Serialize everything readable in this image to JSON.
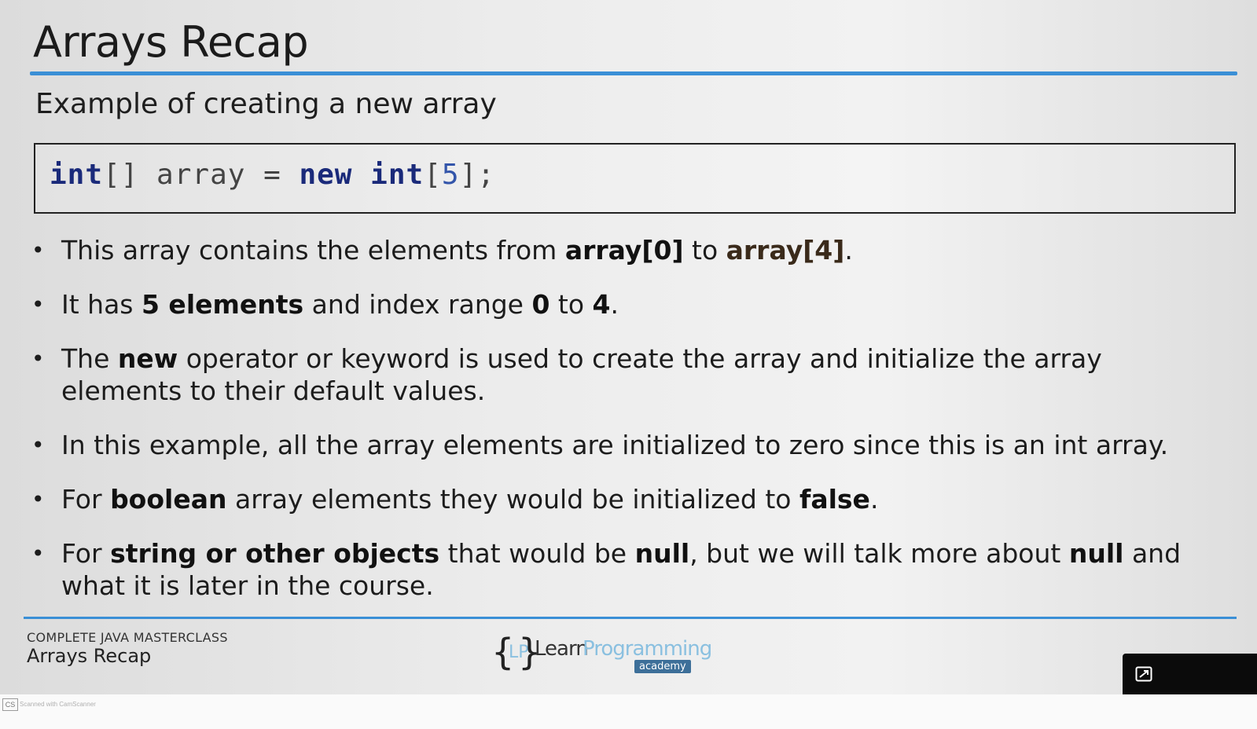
{
  "slide": {
    "title": "Arrays Recap",
    "subtitle": "Example of creating a new array",
    "code": {
      "t1": "int",
      "t2": "[] array = ",
      "t3": "new",
      "t4": " ",
      "t5": "int",
      "t6": "[",
      "t7": "5",
      "t8": "];"
    },
    "bullets": [
      {
        "a": "This array contains the elements from ",
        "b": "array[0]",
        "c": " to ",
        "d": "array[4]",
        "e": "."
      },
      {
        "a": "It has ",
        "b": "5 elements",
        "c": " and index range ",
        "d": "0",
        "e": " to ",
        "f": "4",
        "g": "."
      },
      {
        "a": "The ",
        "b": "new",
        "c": " operator or keyword is used to create the array and initialize the array elements to their default values."
      },
      {
        "a": "In this example, all the array elements are initialized to zero since this is an int array."
      },
      {
        "a": "For ",
        "b": "boolean",
        "c": " array elements they would be initialized to ",
        "d": "false",
        "e": "."
      },
      {
        "a": "For ",
        "b": "string or other objects",
        "c": " that would be ",
        "d": "null",
        "e": ", but we will talk more about ",
        "f": "null",
        "g": " and what it is later in the course."
      }
    ]
  },
  "footer": {
    "course": "COMPLETE JAVA MASTERCLASS",
    "topic": "Arrays Recap",
    "logo": {
      "lp": "LP",
      "learn": "Learn",
      "programming": "Programming",
      "academy": "academy"
    }
  },
  "scanner": {
    "badge": "CS",
    "text": "Scanned with CamScanner"
  },
  "colors": {
    "accent_rule": "#3a8fd6",
    "keyword": "#1a2a7a"
  },
  "icons": {
    "expand": "expand-icon"
  }
}
